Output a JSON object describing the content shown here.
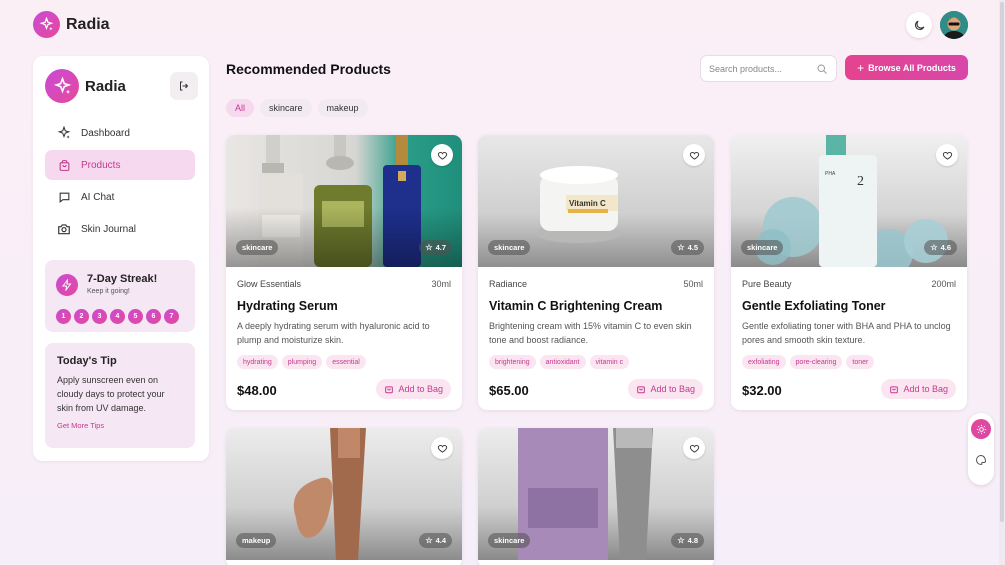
{
  "app": {
    "name": "Radia"
  },
  "sidebar": {
    "brand": "Radia",
    "nav": [
      {
        "label": "Dashboard",
        "icon": "sparkle-icon",
        "active": false
      },
      {
        "label": "Products",
        "icon": "bag-icon",
        "active": true
      },
      {
        "label": "AI Chat",
        "icon": "chat-icon",
        "active": false
      },
      {
        "label": "Skin Journal",
        "icon": "camera-icon",
        "active": false
      }
    ],
    "streak": {
      "title": "7-Day Streak!",
      "subtitle": "Keep it going!",
      "days": [
        "1",
        "2",
        "3",
        "4",
        "5",
        "6",
        "7"
      ]
    },
    "tip": {
      "title": "Today's Tip",
      "text": "Apply sunscreen even on cloudy days to protect your skin from UV damage.",
      "link": "Get More Tips"
    }
  },
  "main": {
    "title": "Recommended Products",
    "search_placeholder": "Search products...",
    "browse_label": "Browse All Products",
    "filters": [
      {
        "label": "All",
        "active": true
      },
      {
        "label": "skincare",
        "active": false
      },
      {
        "label": "makeup",
        "active": false
      }
    ],
    "add_label": "Add to Bag",
    "products": [
      {
        "category": "skincare",
        "rating": "4.7",
        "brand": "Glow Essentials",
        "size": "30ml",
        "name": "Hydrating Serum",
        "description": "A deeply hydrating serum with hyaluronic acid to plump and moisturize skin.",
        "tags": [
          "hydrating",
          "plumping",
          "essential"
        ],
        "price": "$48.00"
      },
      {
        "category": "skincare",
        "rating": "4.5",
        "brand": "Radiance",
        "size": "50ml",
        "name": "Vitamin C Brightening Cream",
        "description": "Brightening cream with 15% vitamin C to even skin tone and boost radiance.",
        "tags": [
          "brightening",
          "antioxidant",
          "vitamin c"
        ],
        "price": "$65.00"
      },
      {
        "category": "skincare",
        "rating": "4.6",
        "brand": "Pure Beauty",
        "size": "200ml",
        "name": "Gentle Exfoliating Toner",
        "description": "Gentle exfoliating toner with BHA and PHA to unclog pores and smooth skin texture.",
        "tags": [
          "exfoliating",
          "pore-clearing",
          "toner"
        ],
        "price": "$32.00"
      },
      {
        "category": "makeup",
        "rating": "4.4"
      },
      {
        "category": "skincare",
        "rating": "4.8"
      }
    ]
  },
  "colors": {
    "accent": "#e4438f",
    "accent_soft": "#fbe5f1",
    "purple": "#c94bd6"
  }
}
